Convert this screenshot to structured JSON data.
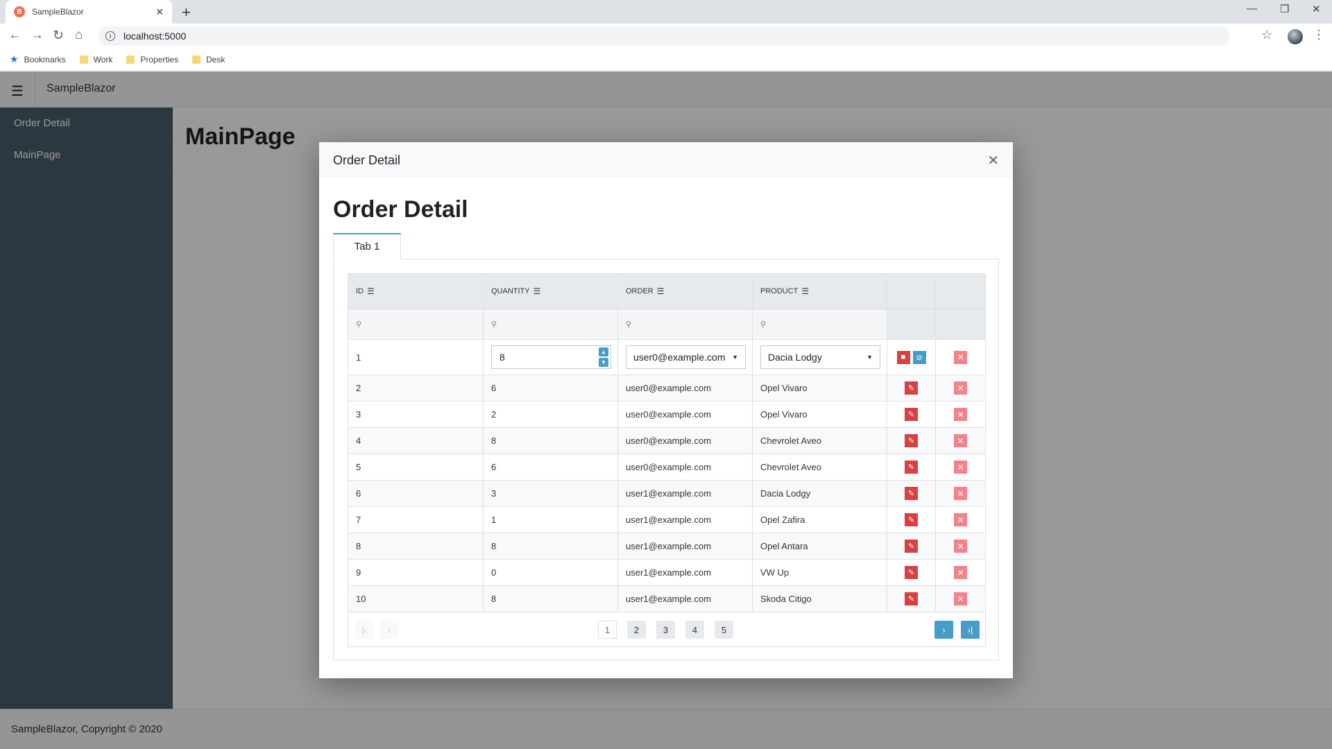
{
  "browser": {
    "tab_title": "SampleBlazor",
    "tab_close": "✕",
    "new_tab": "+",
    "url": "localhost:5000",
    "bookmarks": [
      "Bookmarks",
      "Work",
      "Properties",
      "Desk"
    ]
  },
  "app": {
    "brand": "SampleBlazor",
    "sidebar": [
      {
        "label": "Order Detail"
      },
      {
        "label": "MainPage"
      }
    ],
    "page_title": "MainPage",
    "footer": "SampleBlazor, Copyright © 2020"
  },
  "dialog": {
    "title": "Order Detail",
    "heading": "Order Detail",
    "tab": "Tab 1",
    "columns": [
      "ID",
      "QUANTITY",
      "ORDER",
      "PRODUCT"
    ],
    "edit_row": {
      "id": "1",
      "quantity": "8",
      "order": "user0@example.com",
      "product": "Dacia Lodgy"
    },
    "rows": [
      {
        "id": "2",
        "quantity": "6",
        "order": "user0@example.com",
        "product": "Opel Vivaro"
      },
      {
        "id": "3",
        "quantity": "2",
        "order": "user0@example.com",
        "product": "Opel Vivaro"
      },
      {
        "id": "4",
        "quantity": "8",
        "order": "user0@example.com",
        "product": "Chevrolet Aveo"
      },
      {
        "id": "5",
        "quantity": "6",
        "order": "user0@example.com",
        "product": "Chevrolet Aveo"
      },
      {
        "id": "6",
        "quantity": "3",
        "order": "user1@example.com",
        "product": "Dacia Lodgy"
      },
      {
        "id": "7",
        "quantity": "1",
        "order": "user1@example.com",
        "product": "Opel Zafira"
      },
      {
        "id": "8",
        "quantity": "8",
        "order": "user1@example.com",
        "product": "Opel Antara"
      },
      {
        "id": "9",
        "quantity": "0",
        "order": "user1@example.com",
        "product": "VW Up"
      },
      {
        "id": "10",
        "quantity": "8",
        "order": "user1@example.com",
        "product": "Skoda Citigo"
      }
    ],
    "pager": {
      "pages": [
        "1",
        "2",
        "3",
        "4",
        "5"
      ],
      "current": "1"
    }
  },
  "colors": {
    "accent": "#479cc8",
    "edit": "#d94040",
    "delete": "#f4828a",
    "sidebar": "#4a5e6b"
  }
}
